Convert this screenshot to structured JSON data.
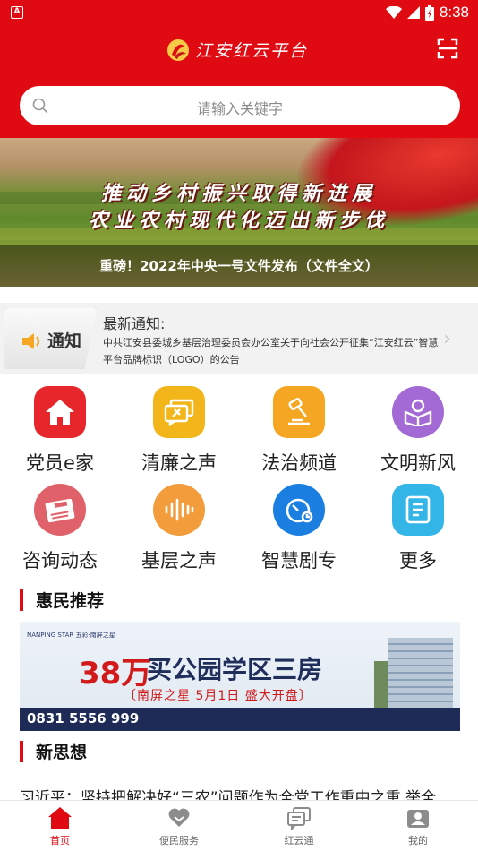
{
  "status_bar": {
    "time": "8:38",
    "left_icon": "A"
  },
  "header": {
    "app_title": "江安红云平台",
    "scan_icon": "scan-icon"
  },
  "search": {
    "placeholder": "请输入关键字"
  },
  "banner": {
    "slogan_line1": "推动乡村振兴取得新进展",
    "slogan_line2": "农业农村现代化迈出新步伐",
    "caption": "重磅！2022年中央一号文件发布（文件全文）"
  },
  "notice": {
    "badge": "通知",
    "heading": "最新通知:",
    "body": "中共江安县委城乡基层治理委员会办公室关于向社会公开征集“江安红云”智慧平台品牌标识（LOGO）的公告"
  },
  "quick_menu": [
    {
      "label": "党员e家",
      "icon": "home-icon",
      "color": "#e6262b"
    },
    {
      "label": "清廉之声",
      "icon": "chat-flag-icon",
      "color": "#f3b61a"
    },
    {
      "label": "法治频道",
      "icon": "gavel-icon",
      "color": "#f5a623"
    },
    {
      "label": "文明新风",
      "icon": "reader-icon",
      "color": "#a36ad6"
    },
    {
      "label": "咨询动态",
      "icon": "news-icon",
      "color": "#e0616a"
    },
    {
      "label": "基层之声",
      "icon": "voice-icon",
      "color": "#f39c3b"
    },
    {
      "label": "智慧剧专",
      "icon": "dial-icon",
      "color": "#1a7fe0"
    },
    {
      "label": "更多",
      "icon": "document-icon",
      "color": "#33b5e8"
    }
  ],
  "section_recommend": {
    "title": "惠民推荐"
  },
  "ad": {
    "brand": "NANPING STAR 五彩·南屏之星",
    "price": "38万",
    "title": "买公园学区三房",
    "subtitle": "〔南屏之星 5月1日 盛大开盘〕",
    "phone": "0831 5556 999"
  },
  "section_thought": {
    "title": "新思想"
  },
  "article_preview": "习近平：坚持把解决好“三农”问题作为全党工作重中之重 举全",
  "tabbar": [
    {
      "label": "首页",
      "icon": "home-tab-icon",
      "active": true
    },
    {
      "label": "便民服务",
      "icon": "heart-tab-icon",
      "active": false
    },
    {
      "label": "红云通",
      "icon": "message-tab-icon",
      "active": false
    },
    {
      "label": "我的",
      "icon": "profile-tab-icon",
      "active": false
    }
  ],
  "colors": {
    "brand_red": "#e00b12",
    "active_tab": "#e00b12"
  }
}
